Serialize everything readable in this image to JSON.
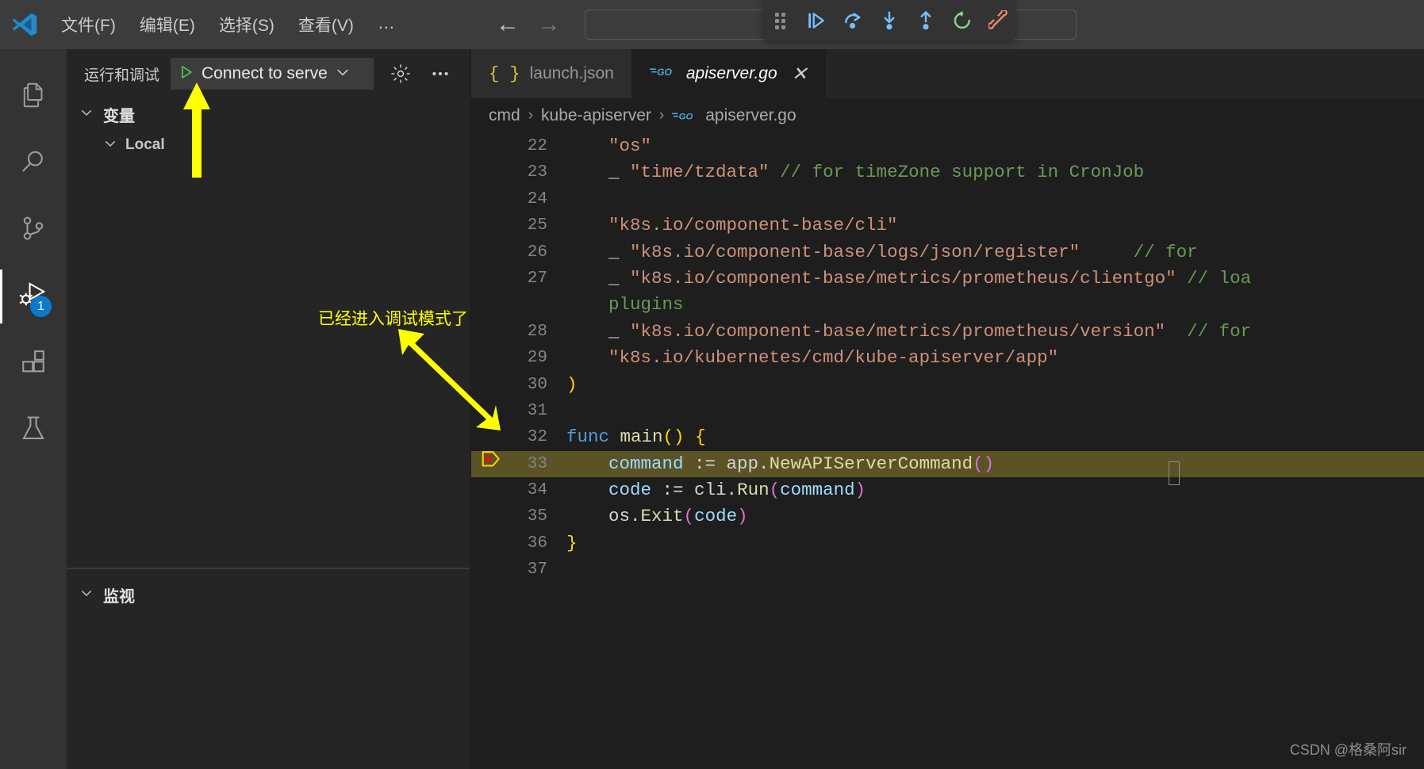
{
  "titlebar": {
    "logo_icon": "vscode-logo",
    "menus": [
      {
        "label": "文件(F)",
        "name": "menu-file"
      },
      {
        "label": "编辑(E)",
        "name": "menu-edit"
      },
      {
        "label": "选择(S)",
        "name": "menu-selection"
      },
      {
        "label": "查看(V)",
        "name": "menu-view"
      },
      {
        "label": "…",
        "name": "menu-more"
      }
    ],
    "nav": {
      "back": "←",
      "forward": "→"
    },
    "command_center_placeholder": ""
  },
  "debug_toolbar": {
    "buttons": [
      {
        "name": "drag-handle-icon",
        "title": "拖动"
      },
      {
        "name": "continue-icon",
        "title": "继续"
      },
      {
        "name": "step-over-icon",
        "title": "单步跳过"
      },
      {
        "name": "step-into-icon",
        "title": "单步调试"
      },
      {
        "name": "step-out-icon",
        "title": "单步跳出"
      },
      {
        "name": "restart-icon",
        "title": "重启"
      },
      {
        "name": "disconnect-icon",
        "title": "断开连接"
      }
    ],
    "colors": {
      "action": "#75beff",
      "restart": "#89d185",
      "disconnect": "#f48771",
      "background": "#333333"
    }
  },
  "activitybar": {
    "items": [
      {
        "name": "explorer",
        "icon": "files-icon",
        "active": false
      },
      {
        "name": "search",
        "icon": "search-icon",
        "active": false
      },
      {
        "name": "source-control",
        "icon": "source-control-icon",
        "active": false
      },
      {
        "name": "run-and-debug",
        "icon": "run-debug-icon",
        "active": true,
        "badge": "1"
      },
      {
        "name": "extensions",
        "icon": "extensions-icon",
        "active": false
      },
      {
        "name": "testing",
        "icon": "beaker-icon",
        "active": false
      }
    ],
    "badge_color": "#0a7aca"
  },
  "sidebar": {
    "title": "运行和调试",
    "launch_config": {
      "label": "Connect to serve",
      "play_icon": "play-icon",
      "chevron": "⌄"
    },
    "gear_icon": "gear-icon",
    "more_icon": "more-icon",
    "sections": [
      {
        "name": "variables",
        "title": "变量",
        "expanded": true,
        "scopes": [
          {
            "name": "local-scope",
            "title": "Local",
            "expanded": true
          }
        ]
      },
      {
        "name": "watch",
        "title": "监视",
        "expanded": true,
        "scopes": []
      }
    ]
  },
  "editor": {
    "tabs": [
      {
        "label": "launch.json",
        "icon": "json-icon",
        "active": false,
        "closable": false
      },
      {
        "label": "apiserver.go",
        "icon": "go-icon",
        "active": true,
        "closable": true,
        "close_glyph": "✕"
      }
    ],
    "breadcrumb": [
      "cmd",
      "kube-apiserver",
      "apiserver.go"
    ],
    "breadcrumb_separator": "›",
    "breadcrumb_file_icon": "go-icon",
    "current_line": 33,
    "breakpoint_line": 33,
    "lines": [
      {
        "n": 22,
        "tokens": [
          {
            "t": "\t",
            "c": "ind"
          },
          {
            "t": "\"os\"",
            "c": "s-str"
          }
        ]
      },
      {
        "n": 23,
        "tokens": [
          {
            "t": "\t",
            "c": "ind"
          },
          {
            "t": "_ ",
            "c": "s-plain"
          },
          {
            "t": "\"time/tzdata\"",
            "c": "s-str"
          },
          {
            "t": " ",
            "c": "s-plain"
          },
          {
            "t": "// for timeZone support in CronJob",
            "c": "s-com"
          }
        ]
      },
      {
        "n": 24,
        "tokens": []
      },
      {
        "n": 25,
        "tokens": [
          {
            "t": "\t",
            "c": "ind"
          },
          {
            "t": "\"k8s.io/component-base/cli\"",
            "c": "s-str"
          }
        ]
      },
      {
        "n": 26,
        "tokens": [
          {
            "t": "\t",
            "c": "ind"
          },
          {
            "t": "_ ",
            "c": "s-plain"
          },
          {
            "t": "\"k8s.io/component-base/logs/json/register\"",
            "c": "s-str"
          },
          {
            "t": "     ",
            "c": "s-plain"
          },
          {
            "t": "// for",
            "c": "s-com"
          }
        ]
      },
      {
        "n": 27,
        "tokens": [
          {
            "t": "\t",
            "c": "ind"
          },
          {
            "t": "_ ",
            "c": "s-plain"
          },
          {
            "t": "\"k8s.io/component-base/metrics/prometheus/clientgo\"",
            "c": "s-str"
          },
          {
            "t": " ",
            "c": "s-plain"
          },
          {
            "t": "// loa",
            "c": "s-com"
          }
        ]
      },
      {
        "n": null,
        "wrap": true,
        "tokens": [
          {
            "t": "\t",
            "c": "ind"
          },
          {
            "t": "plugins",
            "c": "s-com"
          }
        ]
      },
      {
        "n": 28,
        "tokens": [
          {
            "t": "\t",
            "c": "ind"
          },
          {
            "t": "_ ",
            "c": "s-plain"
          },
          {
            "t": "\"k8s.io/component-base/metrics/prometheus/version\"",
            "c": "s-str"
          },
          {
            "t": "  ",
            "c": "s-plain"
          },
          {
            "t": "// for",
            "c": "s-com"
          }
        ]
      },
      {
        "n": 29,
        "tokens": [
          {
            "t": "\t",
            "c": "ind"
          },
          {
            "t": "\"k8s.io/kubernetes/cmd/kube-apiserver/app\"",
            "c": "s-str"
          }
        ]
      },
      {
        "n": 30,
        "tokens": [
          {
            "t": ")",
            "c": "s-pun"
          }
        ]
      },
      {
        "n": 31,
        "tokens": []
      },
      {
        "n": 32,
        "tokens": [
          {
            "t": "func ",
            "c": "s-kw"
          },
          {
            "t": "main",
            "c": "s-fn"
          },
          {
            "t": "()",
            "c": "s-pun"
          },
          {
            "t": " ",
            "c": "s-plain"
          },
          {
            "t": "{",
            "c": "s-pun"
          }
        ]
      },
      {
        "n": 33,
        "tokens": [
          {
            "t": "\t",
            "c": "ind"
          },
          {
            "t": "command",
            "c": "s-var"
          },
          {
            "t": " := ",
            "c": "s-plain"
          },
          {
            "t": "app",
            "c": "s-plain"
          },
          {
            "t": ".",
            "c": "s-plain"
          },
          {
            "t": "NewAPIServerCommand",
            "c": "s-fn"
          },
          {
            "t": "()",
            "c": "s-pun2"
          }
        ]
      },
      {
        "n": 34,
        "tokens": [
          {
            "t": "\t",
            "c": "ind"
          },
          {
            "t": "code",
            "c": "s-var"
          },
          {
            "t": " := ",
            "c": "s-plain"
          },
          {
            "t": "cli",
            "c": "s-plain"
          },
          {
            "t": ".",
            "c": "s-plain"
          },
          {
            "t": "Run",
            "c": "s-fn"
          },
          {
            "t": "(",
            "c": "s-pun2"
          },
          {
            "t": "command",
            "c": "s-var"
          },
          {
            "t": ")",
            "c": "s-pun2"
          }
        ]
      },
      {
        "n": 35,
        "tokens": [
          {
            "t": "\t",
            "c": "ind"
          },
          {
            "t": "os",
            "c": "s-plain"
          },
          {
            "t": ".",
            "c": "s-plain"
          },
          {
            "t": "Exit",
            "c": "s-fn"
          },
          {
            "t": "(",
            "c": "s-pun2"
          },
          {
            "t": "code",
            "c": "s-var"
          },
          {
            "t": ")",
            "c": "s-pun2"
          }
        ]
      },
      {
        "n": 36,
        "tokens": [
          {
            "t": "}",
            "c": "s-pun"
          }
        ]
      },
      {
        "n": 37,
        "tokens": []
      }
    ]
  },
  "annotations": {
    "arrow_color": "#ffff00",
    "note": "已经进入调试模式了",
    "arrow_up_name": "annotation-arrow-to-launch-config",
    "arrow_diagonal_name": "annotation-arrow-to-breakpoint"
  },
  "watermark": "CSDN @格桑阿sir"
}
